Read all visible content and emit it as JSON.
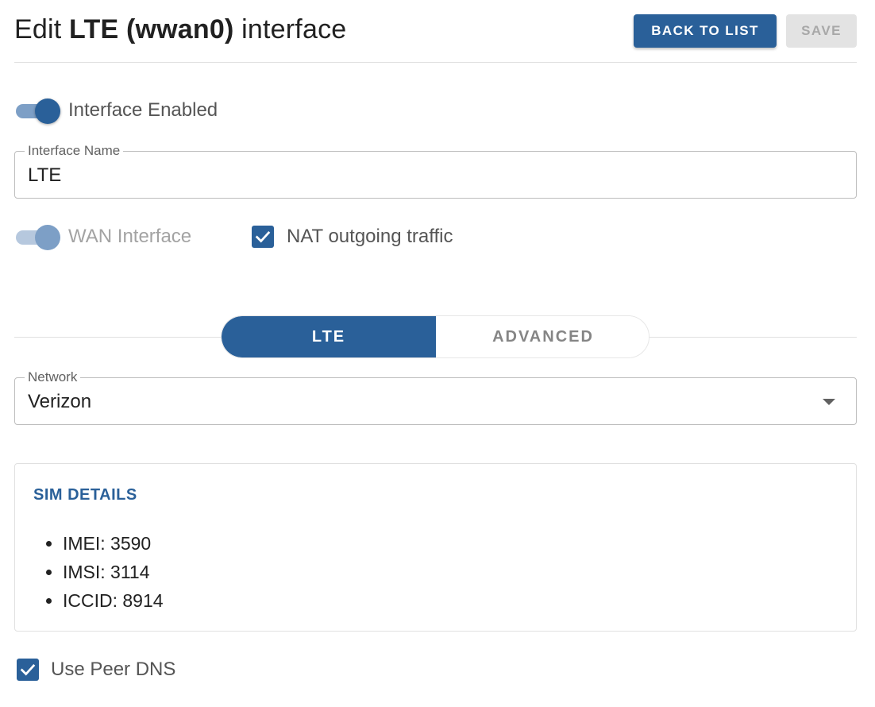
{
  "header": {
    "title_prefix": "Edit",
    "title_name": "LTE (wwan0)",
    "title_suffix": "interface",
    "back_label": "BACK TO LIST",
    "save_label": "SAVE"
  },
  "interface_enabled": {
    "label": "Interface Enabled",
    "on": true
  },
  "interface_name": {
    "label": "Interface Name",
    "value": "LTE"
  },
  "wan_interface": {
    "label": "WAN Interface",
    "on": true,
    "disabled": true
  },
  "nat_outgoing": {
    "label": "NAT outgoing traffic",
    "checked": true
  },
  "tabs": [
    {
      "label": "LTE",
      "active": true
    },
    {
      "label": "ADVANCED",
      "active": false
    }
  ],
  "network": {
    "label": "Network",
    "value": "Verizon"
  },
  "sim_details": {
    "title": "SIM DETAILS",
    "items": [
      "IMEI: 3590",
      "IMSI: 3114",
      "ICCID: 8914"
    ]
  },
  "use_peer_dns": {
    "label": "Use Peer DNS",
    "checked": true
  },
  "colors": {
    "primary": "#2a6099",
    "disabled_bg": "#e3e3e3",
    "disabled_text": "#a8a8a8"
  },
  "icons": {
    "check": "check-icon",
    "dropdown": "arrow-drop-down-icon"
  }
}
